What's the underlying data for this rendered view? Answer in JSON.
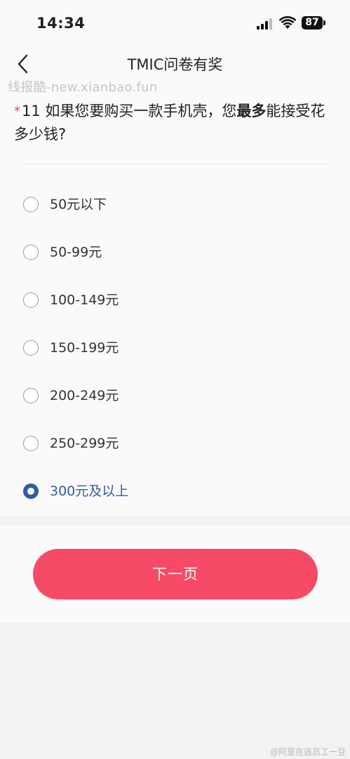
{
  "status_bar": {
    "time": "14:34",
    "battery": "87"
  },
  "nav": {
    "title": "TMIC问卷有奖"
  },
  "watermark": "线报酷-new.xianbao.fun",
  "question": {
    "required_mark": "*",
    "number": "11",
    "text_before": " 如果您要购买一款手机壳，您",
    "text_bold": "最多",
    "text_after": "能接受花多少钱?"
  },
  "options": [
    {
      "label": "50元以下",
      "selected": false
    },
    {
      "label": "50-99元",
      "selected": false
    },
    {
      "label": "100-149元",
      "selected": false
    },
    {
      "label": "150-199元",
      "selected": false
    },
    {
      "label": "200-249元",
      "selected": false
    },
    {
      "label": "250-299元",
      "selected": false
    },
    {
      "label": "300元及以上",
      "selected": true
    }
  ],
  "next_button": "下一页",
  "credit": "@阿里在逃员工一豆",
  "colors": {
    "accent": "#2e5da3",
    "button": "#f74a66",
    "required": "#e24a4f"
  }
}
